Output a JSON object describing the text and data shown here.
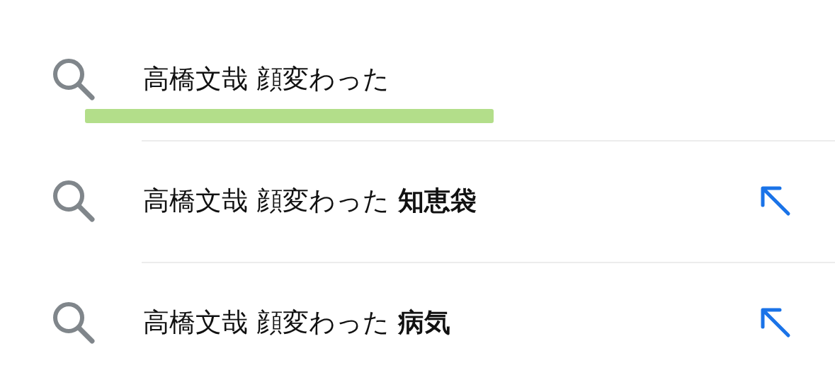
{
  "suggestions": [
    {
      "kind": "query",
      "text": "高橋文哉 顔変わった",
      "highlighted": true
    },
    {
      "kind": "suggestion",
      "text": "高橋文哉 顔変わった **知恵袋**",
      "highlighted": false
    },
    {
      "kind": "suggestion",
      "text": "高橋文哉 顔変わった **病気**",
      "highlighted": false
    }
  ]
}
